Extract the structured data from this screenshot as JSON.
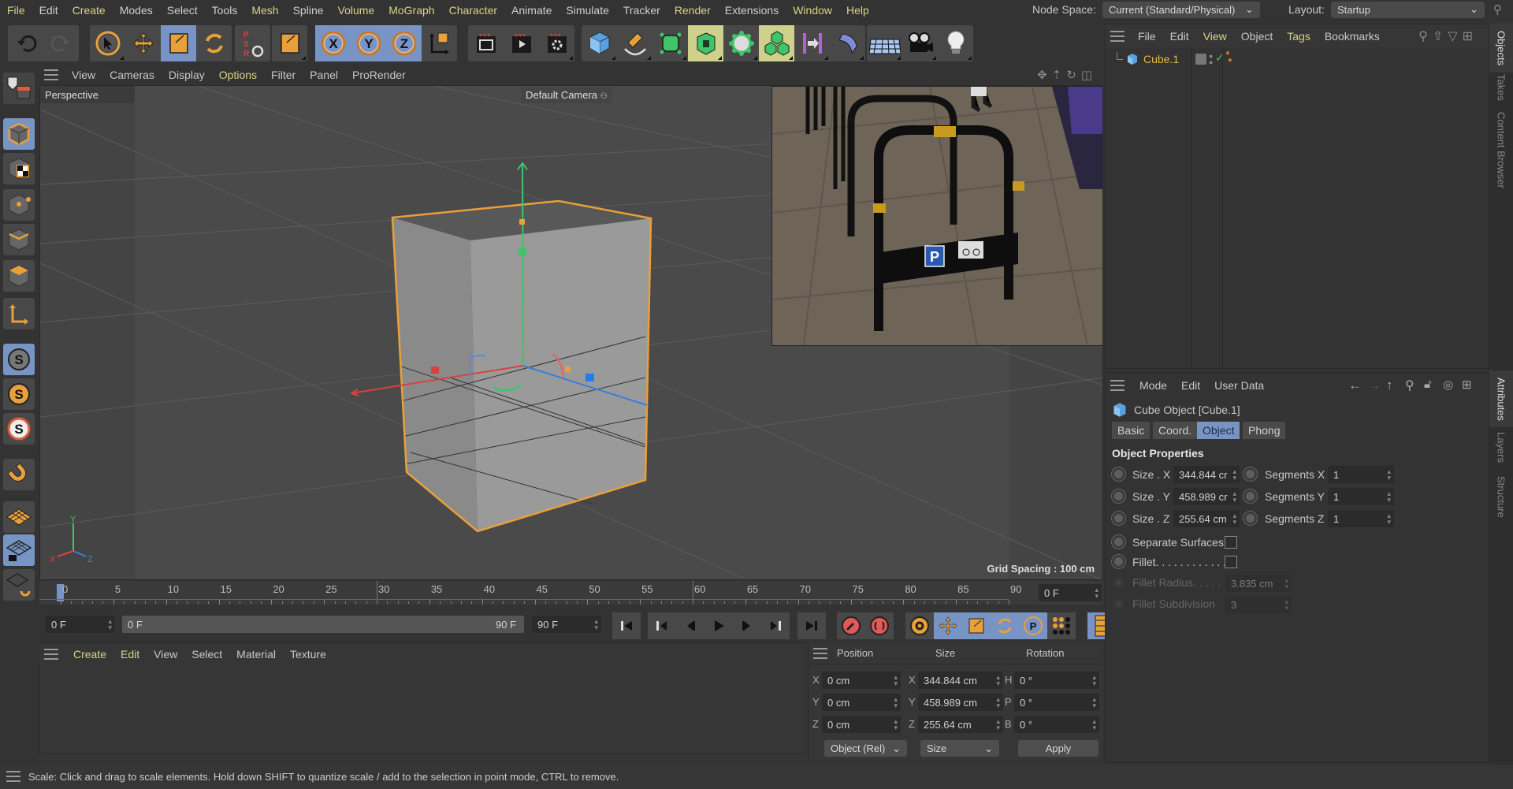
{
  "menubar": {
    "items": [
      {
        "label": "File",
        "accent": true
      },
      {
        "label": "Edit",
        "accent": false
      },
      {
        "label": "Create",
        "accent": true
      },
      {
        "label": "Modes",
        "accent": false
      },
      {
        "label": "Select",
        "accent": false
      },
      {
        "label": "Tools",
        "accent": false
      },
      {
        "label": "Mesh",
        "accent": true
      },
      {
        "label": "Spline",
        "accent": false
      },
      {
        "label": "Volume",
        "accent": true
      },
      {
        "label": "MoGraph",
        "accent": true
      },
      {
        "label": "Character",
        "accent": true
      },
      {
        "label": "Animate",
        "accent": false
      },
      {
        "label": "Simulate",
        "accent": false
      },
      {
        "label": "Tracker",
        "accent": false
      },
      {
        "label": "Render",
        "accent": true
      },
      {
        "label": "Extensions",
        "accent": false
      },
      {
        "label": "Window",
        "accent": true
      },
      {
        "label": "Help",
        "accent": true
      }
    ],
    "node_space_label": "Node Space:",
    "node_space_value": "Current (Standard/Physical)",
    "layout_label": "Layout:",
    "layout_value": "Startup"
  },
  "toolbar": {
    "groups": [
      [
        "undo-icon",
        "redo-icon"
      ],
      [
        "select-icon",
        "move-icon",
        "scale-icon",
        "rotate-icon"
      ],
      [
        "psr-icon"
      ],
      [
        "scale-object-icon"
      ],
      [
        "x-axis-icon",
        "y-axis-icon",
        "z-axis-icon",
        "coordinate-system-icon"
      ],
      [
        "render-view-icon",
        "render-picture-viewer-icon",
        "render-settings-icon"
      ],
      [
        "cube-icon",
        "pen-icon",
        "subdivision-icon",
        "extrude-icon",
        "mograph-cloner-icon",
        "instance-icon",
        "deformer-icon",
        "bend-icon"
      ],
      [
        "floor-icon",
        "camera-icon",
        "light-icon"
      ]
    ],
    "selected": [
      "scale-icon",
      "x-axis-icon",
      "y-axis-icon",
      "z-axis-icon"
    ]
  },
  "left_toolbar": {
    "items": [
      "make-editable-icon",
      "model-mode-icon",
      "texture-mode-icon",
      "points-mode-icon",
      "edges-mode-icon",
      "polygons-mode-icon",
      "axis-mode-icon",
      "solo-off-icon",
      "solo-single-icon",
      "solo-hierarchy-icon",
      "snap-icon",
      "workplane-icon",
      "locked-workplane-icon",
      "workplane-rotate-icon"
    ]
  },
  "viewport": {
    "menu": [
      {
        "label": "View",
        "accent": false
      },
      {
        "label": "Cameras",
        "accent": false
      },
      {
        "label": "Display",
        "accent": false
      },
      {
        "label": "Options",
        "accent": true
      },
      {
        "label": "Filter",
        "accent": false
      },
      {
        "label": "Panel",
        "accent": false
      },
      {
        "label": "ProRender",
        "accent": false
      }
    ],
    "view_name": "Perspective",
    "camera": "Default Camera",
    "grid_spacing": "Grid Spacing : 100 cm",
    "axis_labels": {
      "x": "X",
      "y": "Y",
      "z": "Z"
    }
  },
  "timeline": {
    "ticks": [
      "0",
      "5",
      "10",
      "15",
      "20",
      "25",
      "30",
      "35",
      "40",
      "45",
      "50",
      "55",
      "60",
      "65",
      "70",
      "75",
      "80",
      "85",
      "90"
    ],
    "current_frame_field": "0 F",
    "start_field": "0 F",
    "range_start": "0 F",
    "range_end": "90 F",
    "end_field": "90 F"
  },
  "material_manager": {
    "menu": [
      {
        "label": "Create",
        "accent": true
      },
      {
        "label": "Edit",
        "accent": true
      },
      {
        "label": "View",
        "accent": false
      },
      {
        "label": "Select",
        "accent": false
      },
      {
        "label": "Material",
        "accent": false
      },
      {
        "label": "Texture",
        "accent": false
      }
    ]
  },
  "coordinates": {
    "headers": [
      "Position",
      "Size",
      "Rotation"
    ],
    "rows": [
      {
        "pos_axis": "X",
        "pos": "0 cm",
        "size_axis": "X",
        "size": "344.844 cm",
        "rot_axis": "H",
        "rot": "0 °"
      },
      {
        "pos_axis": "Y",
        "pos": "0 cm",
        "size_axis": "Y",
        "size": "458.989 cm",
        "rot_axis": "P",
        "rot": "0 °"
      },
      {
        "pos_axis": "Z",
        "pos": "0 cm",
        "size_axis": "Z",
        "size": "255.64 cm",
        "rot_axis": "B",
        "rot": "0 °"
      }
    ],
    "mode_select": "Object (Rel)",
    "size_select": "Size",
    "apply_label": "Apply"
  },
  "status": {
    "text": "Scale: Click and drag to scale elements. Hold down SHIFT to quantize scale / add to the selection in point mode, CTRL to remove."
  },
  "objects_panel": {
    "menu": [
      {
        "label": "File",
        "accent": false
      },
      {
        "label": "Edit",
        "accent": false
      },
      {
        "label": "View",
        "accent": true
      },
      {
        "label": "Object",
        "accent": false
      },
      {
        "label": "Tags",
        "accent": true
      },
      {
        "label": "Bookmarks",
        "accent": false
      }
    ],
    "objects": [
      {
        "name": "Cube.1",
        "icon": "cube-icon"
      }
    ]
  },
  "attributes_panel": {
    "menu": [
      "Mode",
      "Edit",
      "User Data"
    ],
    "title": "Cube Object [Cube.1]",
    "tabs": [
      {
        "label": "Basic",
        "active": false
      },
      {
        "label": "Coord.",
        "active": false
      },
      {
        "label": "Object",
        "active": true
      },
      {
        "label": "Phong",
        "active": false
      }
    ],
    "section": "Object Properties",
    "sizes": [
      {
        "label": "Size . X",
        "value": "344.844 cr"
      },
      {
        "label": "Size . Y",
        "value": "458.989 cr"
      },
      {
        "label": "Size . Z",
        "value": "255.64 cm"
      }
    ],
    "segments": [
      {
        "label": "Segments X",
        "value": "1"
      },
      {
        "label": "Segments Y",
        "value": "1"
      },
      {
        "label": "Segments Z",
        "value": "1"
      }
    ],
    "separate_surfaces": {
      "label": "Separate Surfaces",
      "checked": false
    },
    "fillet": {
      "label": "Fillet. . . . . . . . . . . .",
      "checked": false
    },
    "fillet_radius": {
      "label": "Fillet Radius. . . . .",
      "value": "3.835 cm"
    },
    "fillet_subdivision": {
      "label": "Fillet Subdivision",
      "value": "3"
    }
  },
  "side_tabs": {
    "top": [
      {
        "label": "Objects",
        "active": true
      },
      {
        "label": "Takes",
        "active": false
      },
      {
        "label": "Content Browser",
        "active": false
      }
    ],
    "bottom": [
      {
        "label": "Attributes",
        "active": true
      },
      {
        "label": "Layers",
        "active": false
      },
      {
        "label": "Structure",
        "active": false
      }
    ]
  },
  "colors": {
    "accent_menu": "#d9d28a",
    "selection_blue": "#7894c4",
    "object_highlight": "#e8a03a",
    "axis_x": "#d9413a",
    "axis_y": "#3fc46a",
    "axis_z": "#3a7fd9"
  }
}
